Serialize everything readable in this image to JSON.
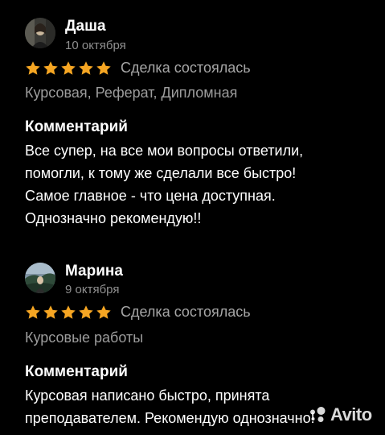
{
  "reviews": [
    {
      "author": "Даша",
      "date": "10 октября",
      "rating": 5,
      "deal_status": "Сделка состоялась",
      "work_types": "Курсовая, Реферат, Дипломная",
      "comment_heading": "Комментарий",
      "comment_lines": [
        "Все супер, на все мои вопросы ответили,",
        "помогли, к тому же сделали все быстро!",
        "Самое главное - что цена доступная.",
        "Однозначно рекомендую!!"
      ]
    },
    {
      "author": "Марина",
      "date": "9 октября",
      "rating": 5,
      "deal_status": "Сделка состоялась",
      "work_types": "Курсовые работы",
      "comment_heading": "Комментарий",
      "comment_lines": [
        "Курсовая написано быстро, принята",
        "преподавателем. Рекомендую однозначно!"
      ]
    }
  ],
  "watermark": {
    "text": "Avito",
    "icon": "avito-logo-icon"
  },
  "colors": {
    "background": "#000000",
    "star": "#f6a623",
    "secondary_text": "#a6a6a6",
    "date_text": "#8f8f8f"
  }
}
